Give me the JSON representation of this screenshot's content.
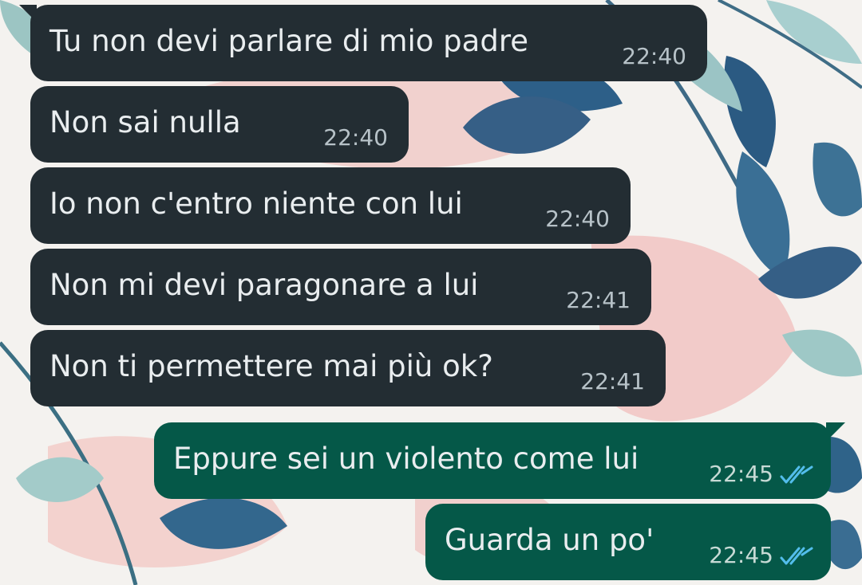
{
  "colors": {
    "incoming_bubble": "#232d33",
    "outgoing_bubble": "#055848",
    "read_ticks": "#53bdeb"
  },
  "messages": [
    {
      "direction": "incoming",
      "text": "Tu non devi parlare di mio padre",
      "time": "22:40"
    },
    {
      "direction": "incoming",
      "text": "Non sai nulla",
      "time": "22:40"
    },
    {
      "direction": "incoming",
      "text": "Io non c'entro niente con lui",
      "time": "22:40"
    },
    {
      "direction": "incoming",
      "text": "Non mi devi paragonare a lui",
      "time": "22:41"
    },
    {
      "direction": "incoming",
      "text": "Non ti permettere mai più ok?",
      "time": "22:41"
    },
    {
      "direction": "outgoing",
      "text": "Eppure sei un violento come lui",
      "time": "22:45",
      "status": "read-ticks-icon"
    },
    {
      "direction": "outgoing",
      "text": "Guarda un po'",
      "time": "22:45",
      "status": "read-ticks-icon"
    }
  ]
}
